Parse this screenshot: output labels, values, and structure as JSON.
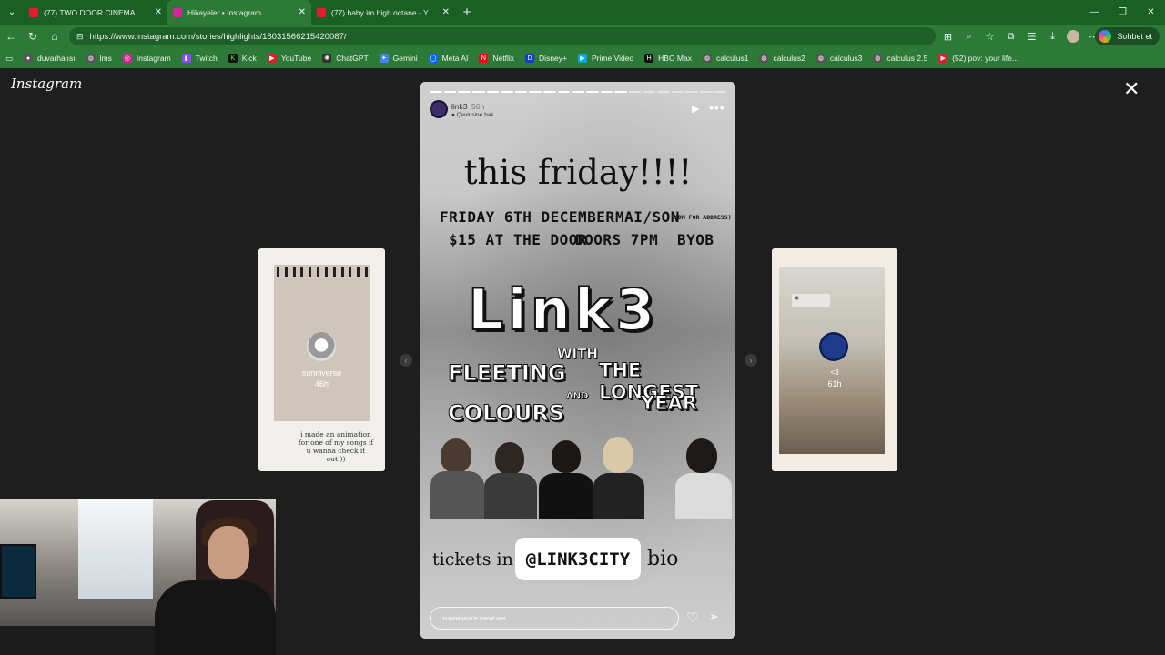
{
  "browser": {
    "tabs": [
      {
        "title": "(77) TWO DOOR CINEMA CLUB | S",
        "color": "#e11d2b",
        "active": false
      },
      {
        "title": "Hikayeler • Instagram",
        "color": "#d6249f",
        "active": true
      },
      {
        "title": "(77) baby im high octane - YouTub",
        "color": "#e11d2b",
        "active": false
      }
    ],
    "url": "https://www.instagram.com/stories/highlights/18031566215420087/",
    "copilot_label": "Sohbet et",
    "bookmarks": [
      {
        "label": "duvarhalısı",
        "color": "#555555",
        "icon": "globe-icon"
      },
      {
        "label": "lms",
        "color": "#555555",
        "icon": "globe-icon"
      },
      {
        "label": "Instagram",
        "color": "#d6249f",
        "icon": "instagram-icon"
      },
      {
        "label": "Twitch",
        "color": "#9146ff",
        "icon": "twitch-icon"
      },
      {
        "label": "Kick",
        "color": "#53fc18",
        "icon": "kick-icon"
      },
      {
        "label": "YouTube",
        "color": "#e11d2b",
        "icon": "youtube-icon"
      },
      {
        "label": "ChatGPT",
        "color": "#333333",
        "icon": "chatgpt-icon"
      },
      {
        "label": "Gemini",
        "color": "#4285f4",
        "icon": "gemini-icon"
      },
      {
        "label": "Meta AI",
        "color": "#0866ff",
        "icon": "meta-icon"
      },
      {
        "label": "Netflix",
        "color": "#e50914",
        "icon": "netflix-icon"
      },
      {
        "label": "Disney+",
        "color": "#113ccf",
        "icon": "disney-icon"
      },
      {
        "label": "Prime Video",
        "color": "#00a8e1",
        "icon": "prime-icon"
      },
      {
        "label": "HBO Max",
        "color": "#111111",
        "icon": "hbo-icon"
      },
      {
        "label": "calculus1",
        "color": "#555555",
        "icon": "globe-icon"
      },
      {
        "label": "calculus2",
        "color": "#555555",
        "icon": "globe-icon"
      },
      {
        "label": "calculus3",
        "color": "#555555",
        "icon": "globe-icon"
      },
      {
        "label": "calculus 2.5",
        "color": "#555555",
        "icon": "globe-icon"
      },
      {
        "label": "(52) pov: your life...",
        "color": "#e11d2b",
        "icon": "youtube-icon"
      }
    ]
  },
  "instagram": {
    "logo_text": "Instagram",
    "left_story": {
      "username": "sunniverse",
      "age": "46h",
      "caption": "i made an animation for one of my songs if u wanna check it out:))"
    },
    "right_story": {
      "username": "<3",
      "age": "61h"
    },
    "main_story": {
      "username": "link3",
      "age": "56h",
      "translate_label": "Çevirisine bak",
      "progress_segments": 21,
      "progress_done": 14,
      "poster": {
        "headline": "this friday!!!!",
        "line1_left": "FRIDAY 6TH DECEMBER",
        "line1_right": "MAI/SON",
        "line1_note": "(DM FOR ADDRESS)",
        "line2_left": "$15 AT THE DOOR",
        "line2_mid": "DOORS 7PM",
        "line2_right": "BYOB",
        "band_name": "Link3",
        "with_label": "WITH",
        "and_label": "AND",
        "support1_line1": "FLEETING",
        "support1_line2": "COLOURS",
        "support2_line1": "THE LONGEST",
        "support2_line2": "YEAR",
        "tickets_prefix": "tickets in",
        "tickets_handle": "@LINK3CITY",
        "tickets_suffix": "bio"
      },
      "reply_placeholder": "sunnivvva'e yanıt ver..."
    }
  }
}
